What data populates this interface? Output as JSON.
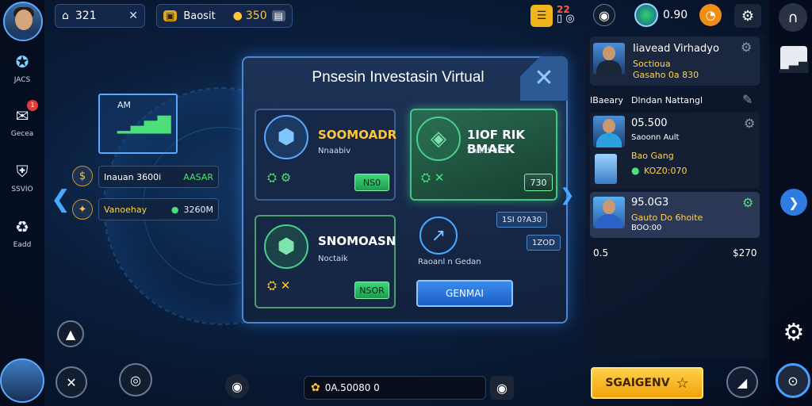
{
  "top_bar": {
    "home_value": "321",
    "boost_label": "Baosit",
    "coins_value": "350",
    "level_value": "22",
    "gems_value": "0.90"
  },
  "left_rail": {
    "items": [
      {
        "label": "JACS",
        "icon": "star-badge-icon"
      },
      {
        "label": "Gecea",
        "icon": "mail-icon"
      },
      {
        "label": "SSVIO",
        "icon": "shield-icon"
      },
      {
        "label": "Eadd",
        "icon": "recycle-icon"
      }
    ],
    "notification_count": "1"
  },
  "left_info": {
    "building_label": "AM",
    "row1": {
      "label": "Inauan 3600i",
      "value": "AASAR",
      "icon": "coin-icon"
    },
    "row2": {
      "label": "Vanoehay",
      "value": "3260M",
      "icon": "coin-icon"
    }
  },
  "modal": {
    "title": "Pnsesin Investasin Virtual",
    "cards": [
      {
        "title": "SOOMOADR",
        "subtitle": "Nnaabiv",
        "button": "NS0"
      },
      {
        "title": "1IOF RIK BMAEK",
        "subtitle": "Tnard 065",
        "button": "730"
      },
      {
        "title": "SNOMOASN",
        "subtitle": "Noctaik",
        "button": "NSOR"
      }
    ],
    "rate_badge_1": "1SI 0?A30",
    "rate_badge_2": "1ZOD",
    "chart_caption": "Raoanl n Gedan",
    "action_button": "GENMAI"
  },
  "right_panel": {
    "header": {
      "name": "Iiavead Virhadyo",
      "sub1": "Soctioua",
      "sub2": "Gasaho 0a 830"
    },
    "tabs": {
      "left": "IBaeary",
      "right": "Dlndan Nattangl"
    },
    "items": [
      {
        "amount": "05.500",
        "line1": "Saoonn Ault",
        "line2": "Bao Gang",
        "line3": "KOZ0:070"
      },
      {
        "amount": "95.0G3",
        "line1": "Gauto Do 6hoite",
        "line2": "BOO:00"
      }
    ],
    "footer": {
      "left": "0.5",
      "right": "$270"
    }
  },
  "bottom_bar": {
    "coins_text": "0A.50080 0"
  },
  "search_button": "SGAIGENV",
  "colors": {
    "accent": "#4e86c9",
    "gold": "#ffc53a",
    "green": "#44c585"
  }
}
